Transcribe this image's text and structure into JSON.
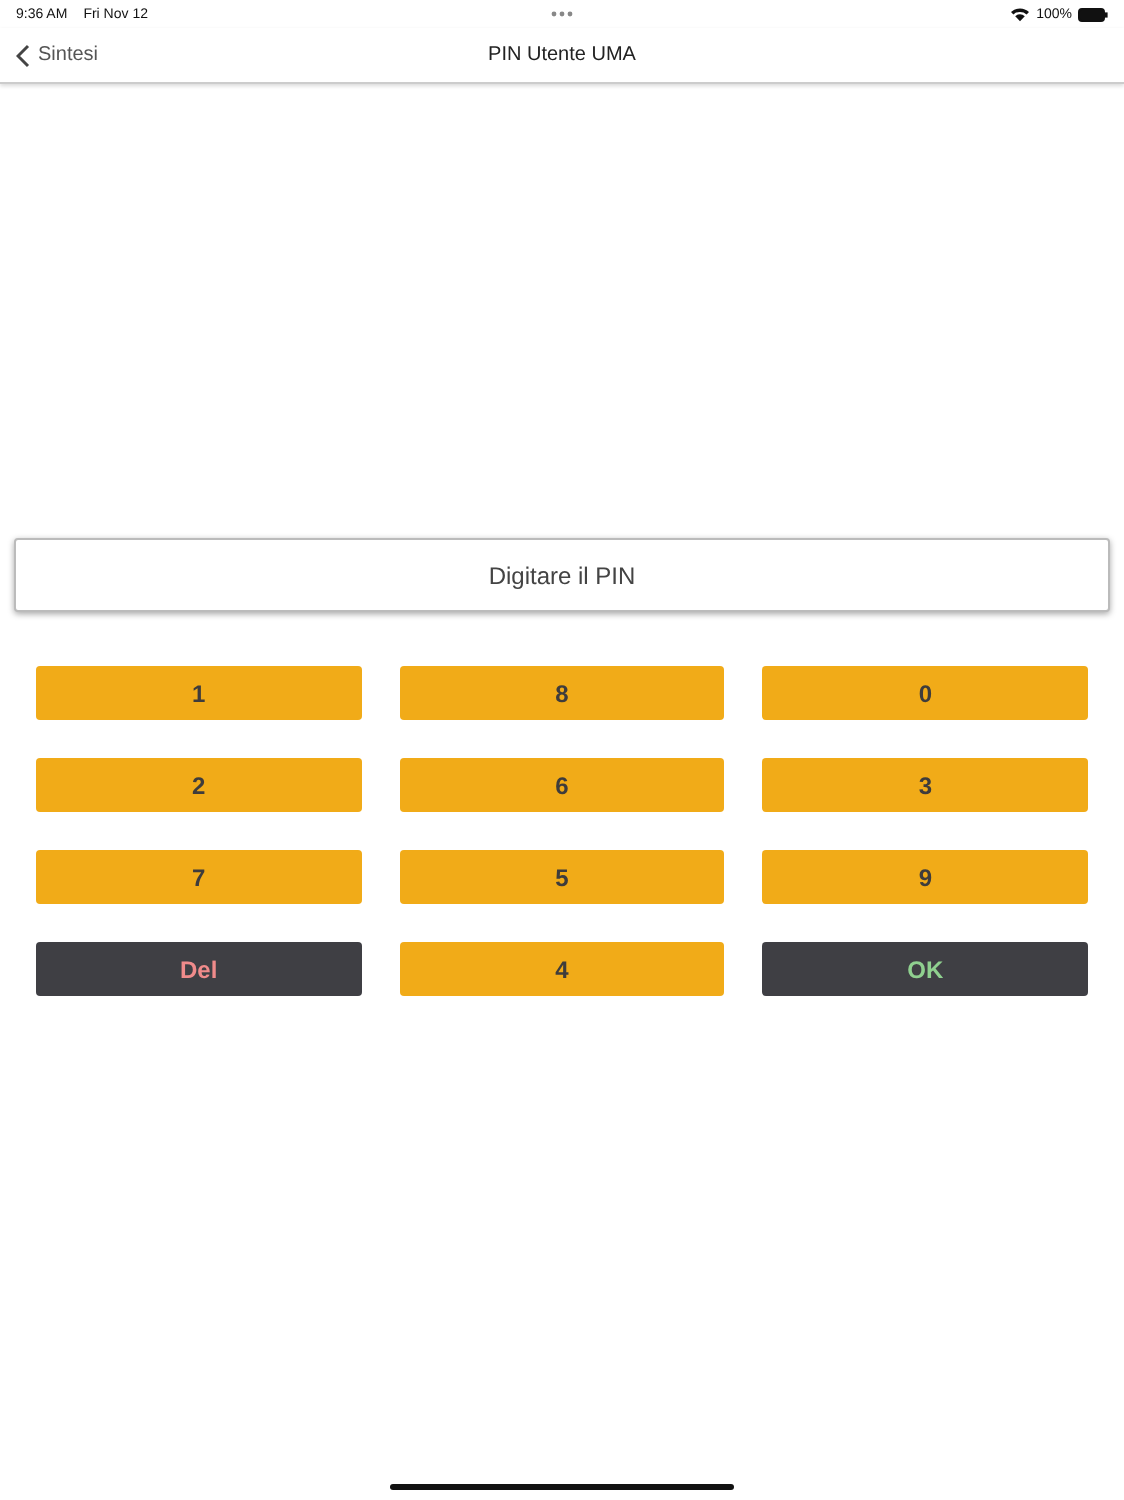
{
  "status_bar": {
    "time": "9:36 AM",
    "date": "Fri Nov 12",
    "battery": "100%"
  },
  "nav": {
    "back": "Sintesi",
    "title": "PIN Utente UMA"
  },
  "pin_field": {
    "placeholder": "Digitare il PIN"
  },
  "keys": [
    {
      "label": "1",
      "kind": "digit"
    },
    {
      "label": "8",
      "kind": "digit"
    },
    {
      "label": "0",
      "kind": "digit"
    },
    {
      "label": "2",
      "kind": "digit"
    },
    {
      "label": "6",
      "kind": "digit"
    },
    {
      "label": "3",
      "kind": "digit"
    },
    {
      "label": "7",
      "kind": "digit"
    },
    {
      "label": "5",
      "kind": "digit"
    },
    {
      "label": "9",
      "kind": "digit"
    },
    {
      "label": "Del",
      "kind": "delete"
    },
    {
      "label": "4",
      "kind": "digit"
    },
    {
      "label": "OK",
      "kind": "confirm"
    }
  ]
}
